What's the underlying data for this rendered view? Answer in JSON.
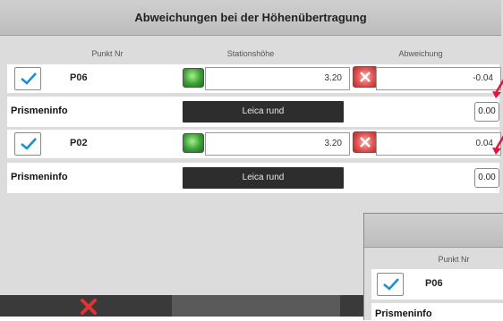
{
  "dialog": {
    "title": "Abweichungen bei der Höhenübertragung",
    "columns": {
      "point_no": "Punkt Nr",
      "station_height": "Stationshöhe",
      "deviation": "Abweichung"
    },
    "rows": [
      {
        "point": "P06",
        "checked": true,
        "station_height": "3.20",
        "height_status": "ok-green",
        "deviation": "-0.04",
        "deviation_status": "error-red",
        "prism_label": "Prismeninfo",
        "prism_button": "Leica rund",
        "prism_value": "0.00"
      },
      {
        "point": "P02",
        "checked": true,
        "station_height": "3.20",
        "height_status": "ok-green",
        "deviation": "0.04",
        "deviation_status": "error-red",
        "prism_label": "Prismeninfo",
        "prism_button": "Leica rund",
        "prism_value": "0.00"
      }
    ],
    "footer": {
      "cancel_icon": "red-x-icon",
      "ok_icon": ""
    }
  },
  "overlay": {
    "column_point_no": "Punkt Nr",
    "point": "P06",
    "prism_label_partial": "Prismeninfo"
  },
  "colors": {
    "accent_check": "#1a8fd6",
    "error": "#d93b3b",
    "ok": "#3aa036",
    "button_dark": "#2d2d2d",
    "annotation_arrow": "#e0143c"
  }
}
